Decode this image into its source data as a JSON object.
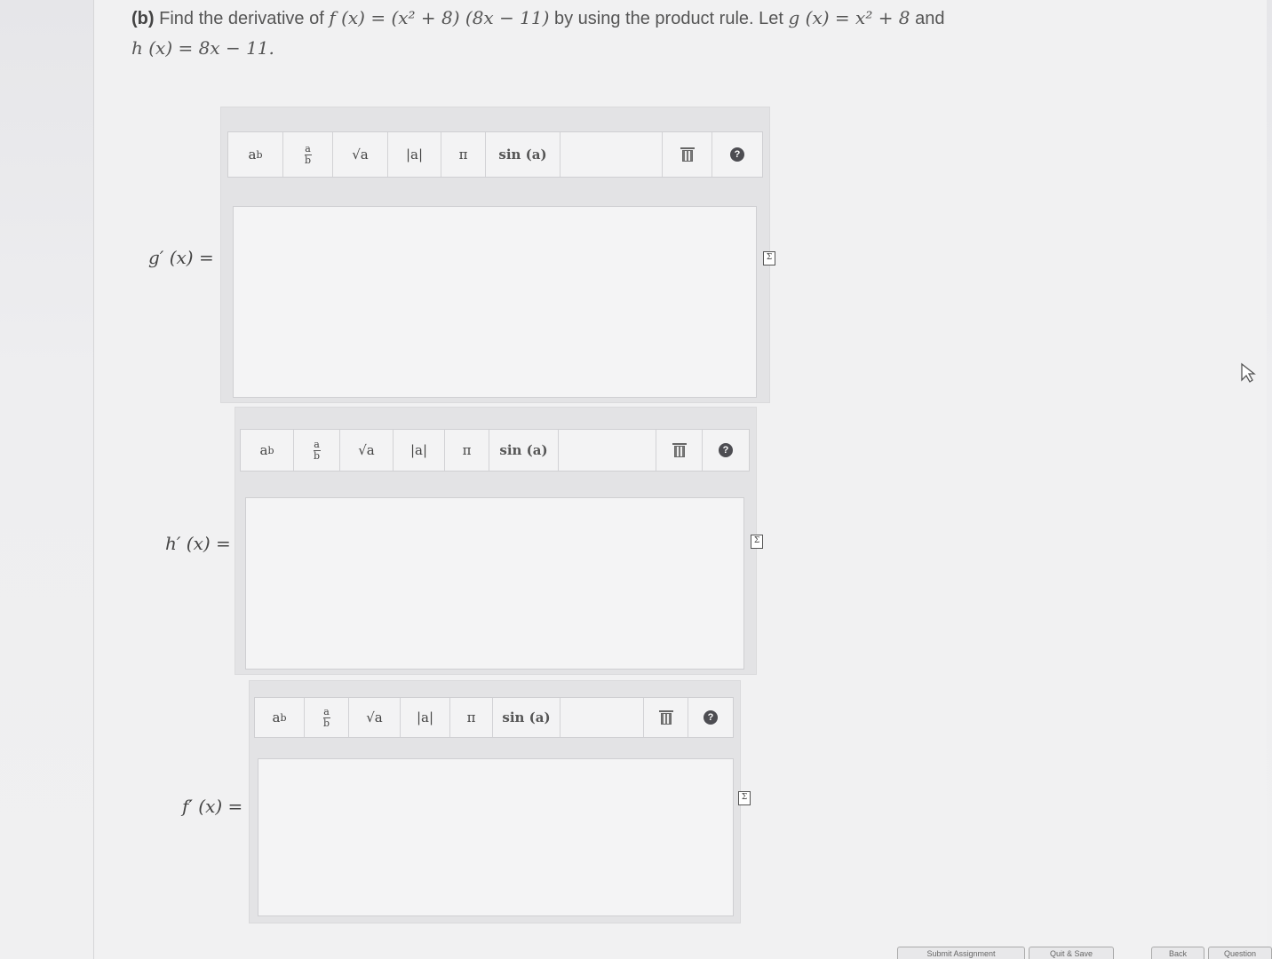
{
  "question": {
    "part_label": "(b)",
    "text_1": "Find the derivative of",
    "func_f": "f (x) = (x² + 8) (8x − 11)",
    "text_2": "by using the product rule. Let",
    "func_g": "g (x) = x² + 8",
    "text_3": "and",
    "func_h": "h (x) = 8x − 11."
  },
  "toolbar": {
    "power": "a",
    "power_sup": "b",
    "frac_num": "a",
    "frac_den": "b",
    "sqrt": "√a",
    "abs": "|a|",
    "pi": "π",
    "sin": "sin (a)",
    "trash_icon": "trash-icon",
    "help": "?"
  },
  "answers": [
    {
      "label": "g′ (x) =",
      "value": ""
    },
    {
      "label": "h′ (x) =",
      "value": ""
    },
    {
      "label": "f′ (x) =",
      "value": ""
    }
  ],
  "footer": {
    "btn_1": "Submit Assignment",
    "btn_2": "Quit & Save",
    "btn_3": "Back",
    "btn_4": "Question"
  }
}
